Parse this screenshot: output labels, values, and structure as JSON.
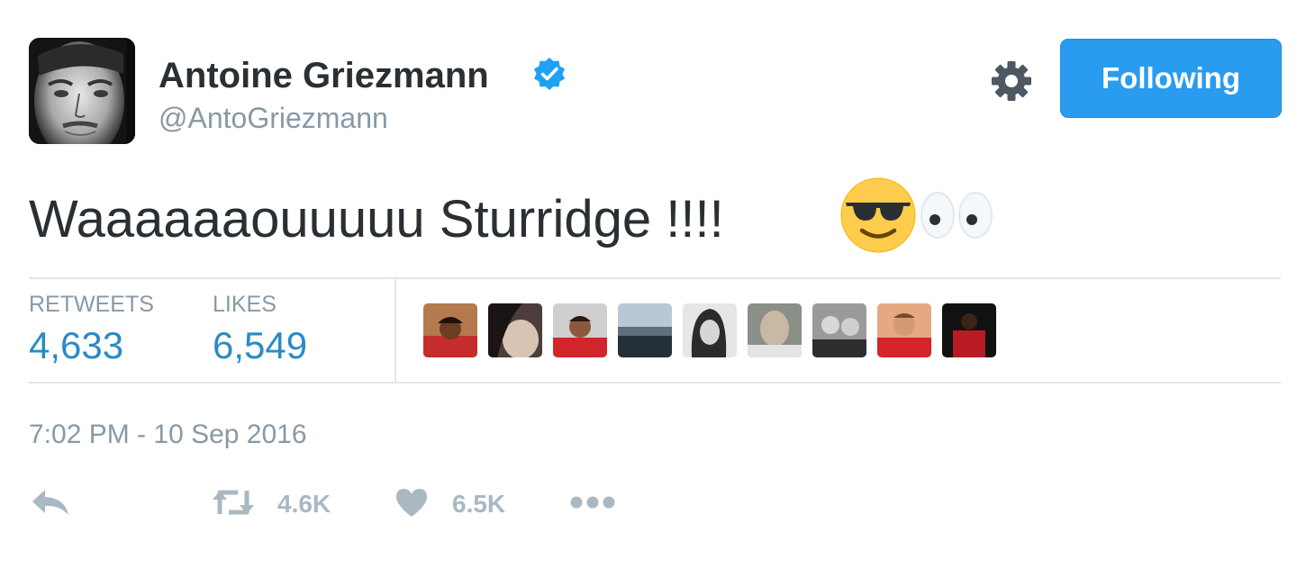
{
  "profile": {
    "display_name": "Antoine Griezmann",
    "handle": "@AntoGriezmann",
    "verified_icon": "verified-badge-icon",
    "accent_color": "#2a9cf0"
  },
  "header": {
    "follow_label": "Following",
    "settings_icon": "gear-icon"
  },
  "tweet": {
    "text": "Waaaaaaouuuuu Sturridge !!!!",
    "emojis": [
      "smiling-face-with-sunglasses",
      "eyes"
    ]
  },
  "stats": {
    "retweets_label": "RETWEETS",
    "retweets_value": "4,633",
    "likes_label": "LIKES",
    "likes_value": "6,549"
  },
  "likers": [
    {
      "name": "liker-avatar-1"
    },
    {
      "name": "liker-avatar-2"
    },
    {
      "name": "liker-avatar-3"
    },
    {
      "name": "liker-avatar-4"
    },
    {
      "name": "liker-avatar-5"
    },
    {
      "name": "liker-avatar-6"
    },
    {
      "name": "liker-avatar-7"
    },
    {
      "name": "liker-avatar-8"
    },
    {
      "name": "liker-avatar-9"
    }
  ],
  "timestamp": "7:02 PM - 10 Sep 2016",
  "actions": {
    "reply_icon": "reply-icon",
    "retweet_icon": "retweet-icon",
    "retweet_count": "4.6K",
    "like_icon": "heart-icon",
    "like_count": "6.5K",
    "more_icon": "more-dots-icon"
  }
}
